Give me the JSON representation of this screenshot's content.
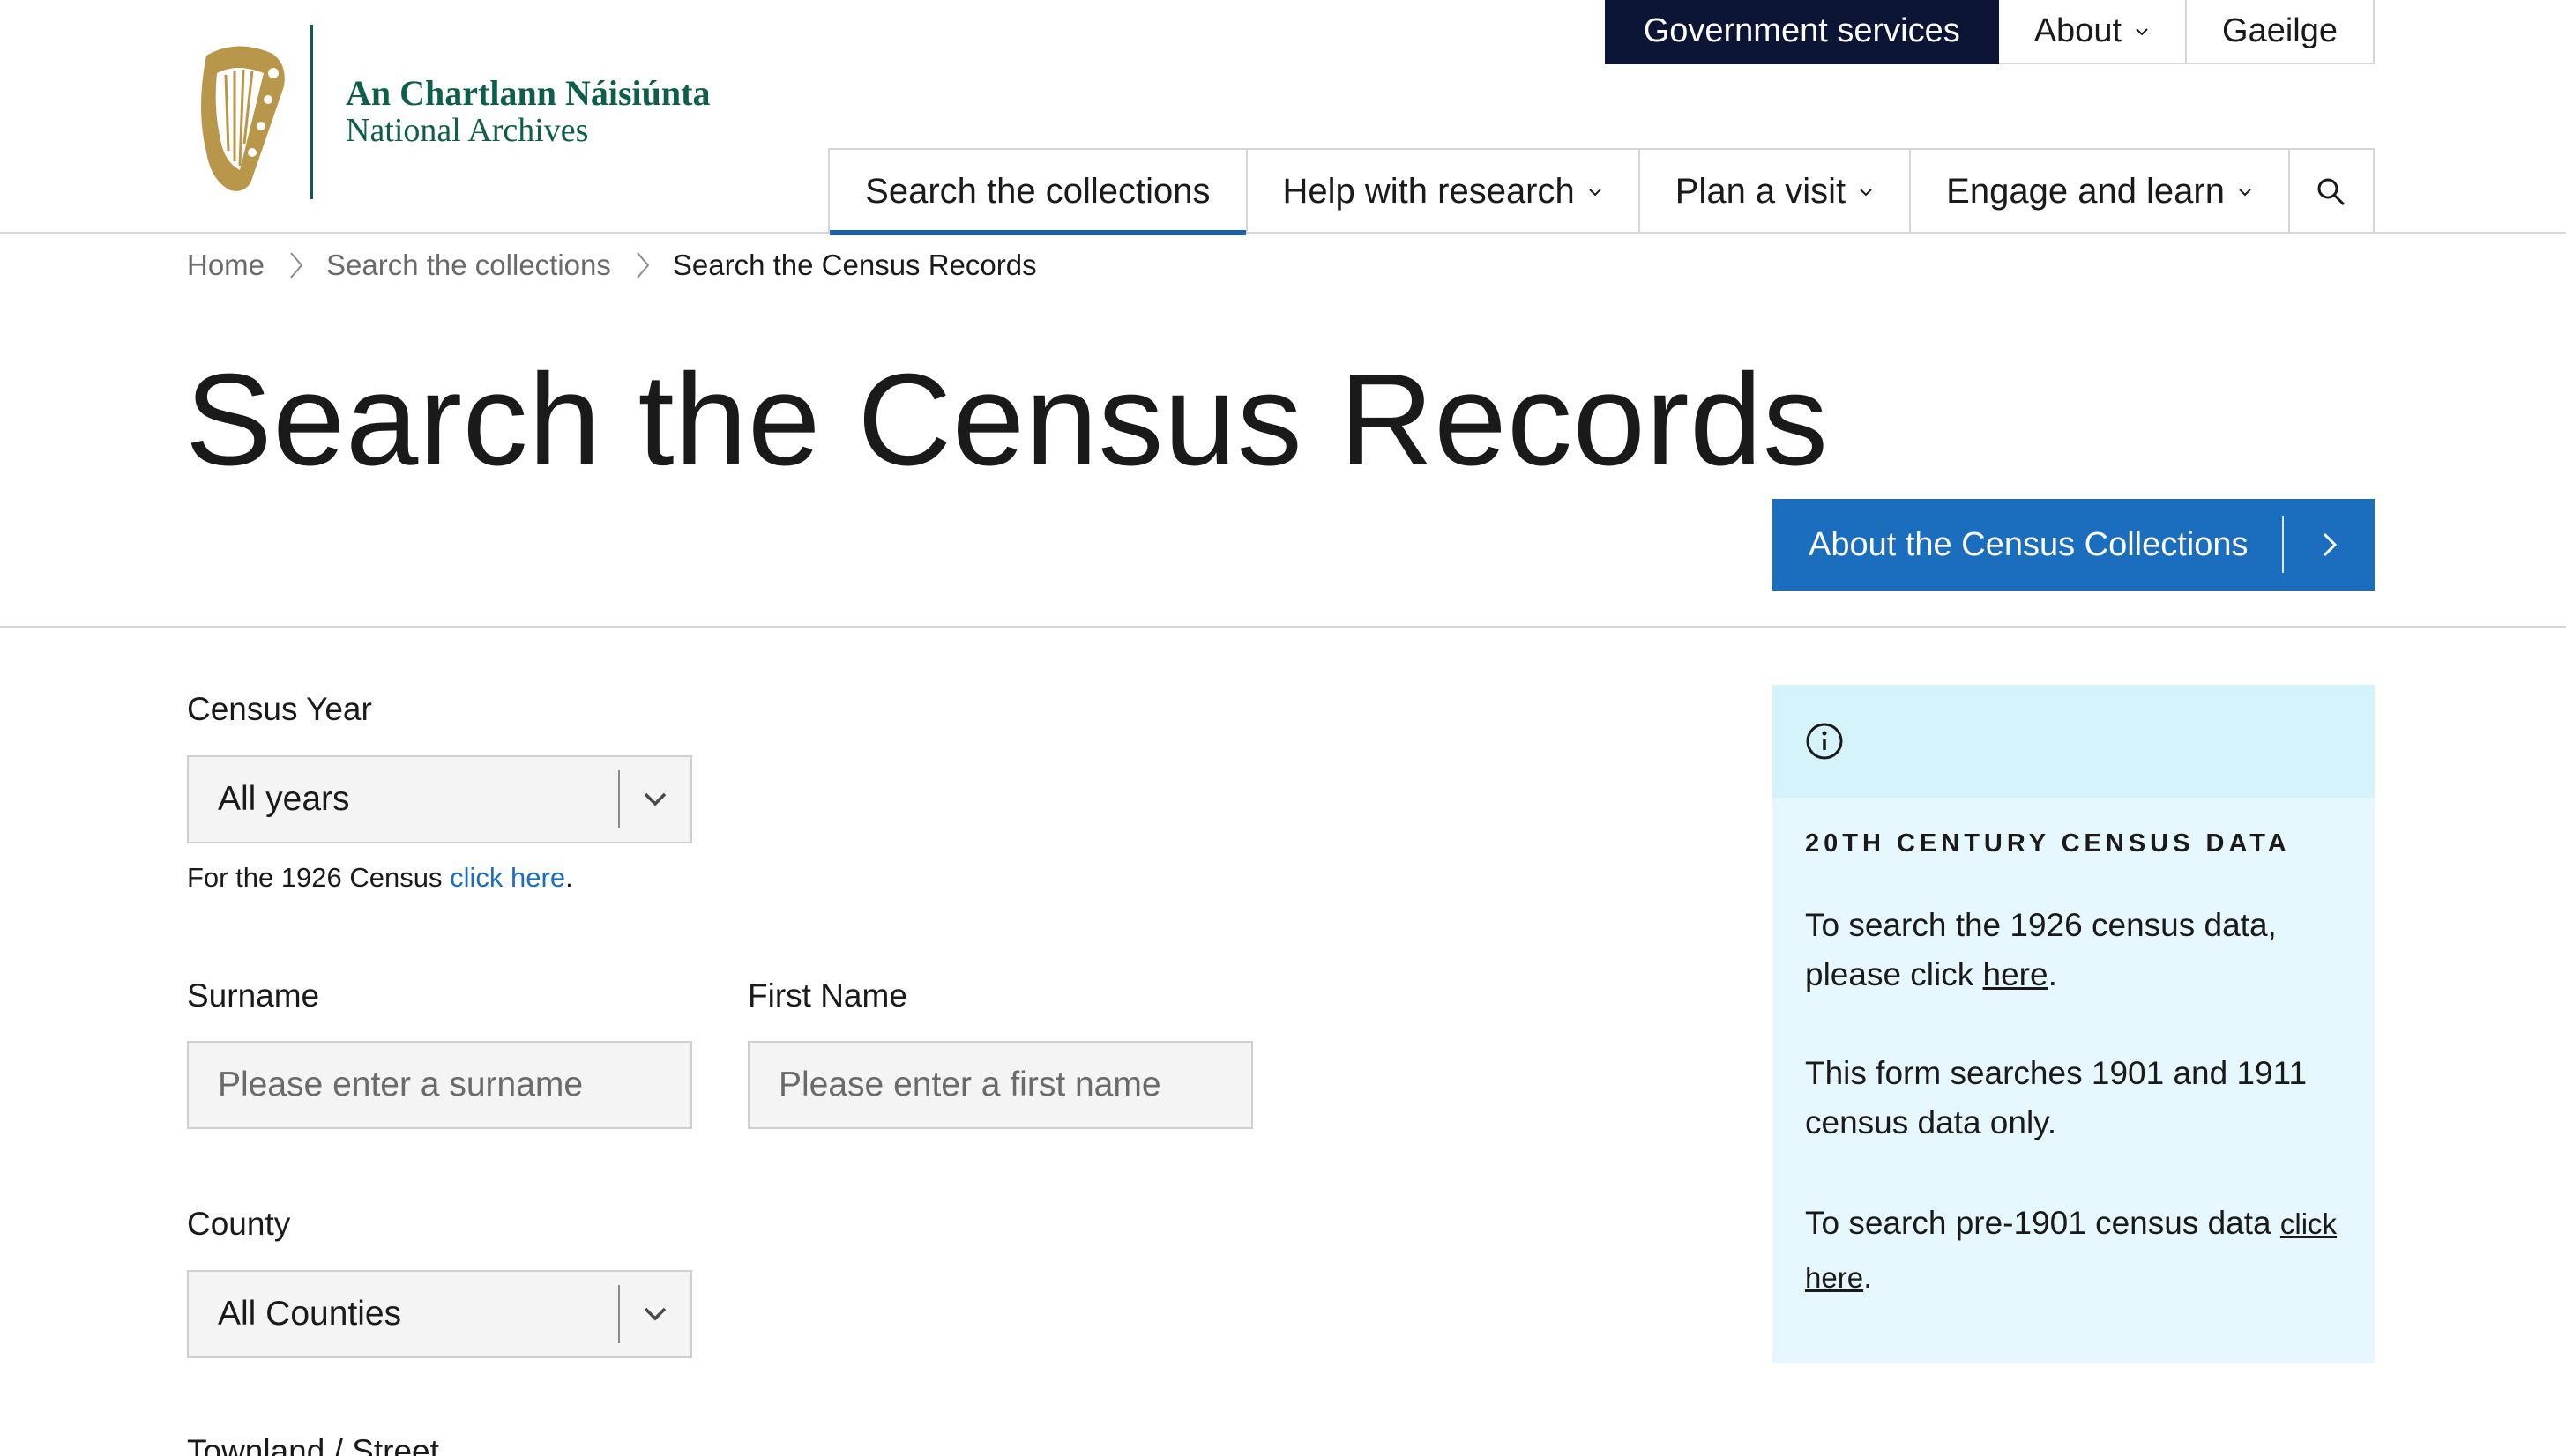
{
  "header": {
    "org_name_irish": "An Chartlann Náisiúnta",
    "org_name_english": "National Archives",
    "utility_nav": {
      "government_services": "Government services",
      "about": "About",
      "language": "Gaeilge"
    },
    "main_nav": [
      {
        "label": "Search the collections",
        "active": true,
        "has_dropdown": false
      },
      {
        "label": "Help with research",
        "active": false,
        "has_dropdown": true
      },
      {
        "label": "Plan a visit",
        "active": false,
        "has_dropdown": true
      },
      {
        "label": "Engage and learn",
        "active": false,
        "has_dropdown": true
      }
    ],
    "search_icon": "search-icon"
  },
  "breadcrumb": {
    "home": "Home",
    "collections": "Search the collections",
    "current": "Search the Census Records"
  },
  "page": {
    "title": "Search the Census Records",
    "about_button": "About the Census Collections"
  },
  "form": {
    "census_year": {
      "label": "Census Year",
      "value": "All years"
    },
    "hint_prefix": "For the 1926 Census ",
    "hint_link": "click here",
    "hint_suffix": ".",
    "surname": {
      "label": "Surname",
      "placeholder": "Please enter a surname",
      "value": ""
    },
    "first_name": {
      "label": "First Name",
      "placeholder": "Please enter a first name",
      "value": ""
    },
    "county": {
      "label": "County",
      "value": "All Counties"
    },
    "townland": {
      "label": "Townland / Street"
    }
  },
  "info_panel": {
    "icon": "info-icon",
    "heading": "20TH CENTURY CENSUS DATA",
    "p1_text": "To search the 1926 census data, please click ",
    "p1_link": "here",
    "p1_end": ".",
    "p2_text": "This form searches 1901 and 1911 census data only.",
    "p3_text": "To search pre-1901 census data ",
    "p3_link": "click here",
    "p3_end": "."
  },
  "colors": {
    "brand_green": "#0f5e4c",
    "harp_gold": "#b8964a",
    "gov_navy": "#0c1536",
    "accent_blue": "#1a6ebd",
    "info_bg": "#e6f8fd",
    "info_top_bg": "#d5f3fb"
  }
}
